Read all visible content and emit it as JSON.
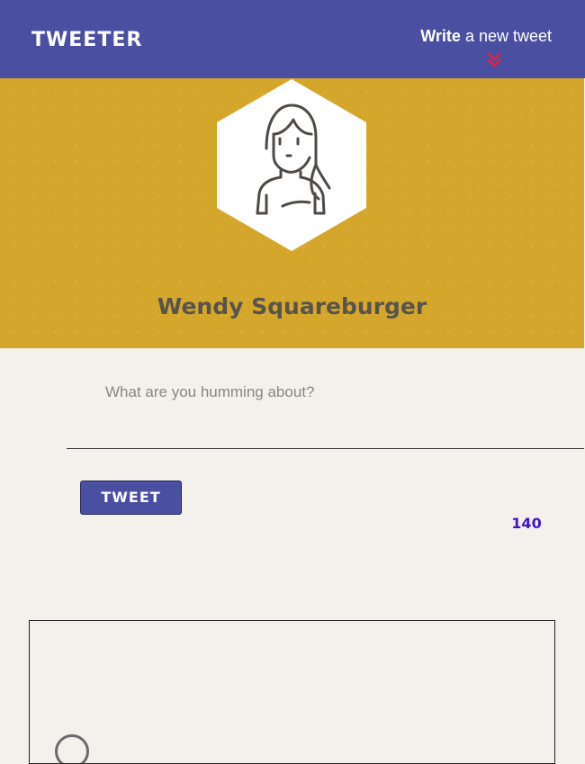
{
  "nav": {
    "logo": "TWEETER",
    "compose_strong": "Write",
    "compose_rest": " a new tweet",
    "compose_icon": "double-chevron-down-icon",
    "compose_icon_color": "#e8213f"
  },
  "profile": {
    "avatar_icon": "woman-avatar-icon",
    "name": "Wendy Squareburger",
    "banner_color": "#d4a72c"
  },
  "compose": {
    "placeholder": "What are you humming about?",
    "value": "",
    "button_label": "TWEET",
    "char_count": "140",
    "counter_color": "#3b16d6"
  },
  "colors": {
    "primary": "#4a4fa2",
    "background": "#f4f1ec"
  }
}
